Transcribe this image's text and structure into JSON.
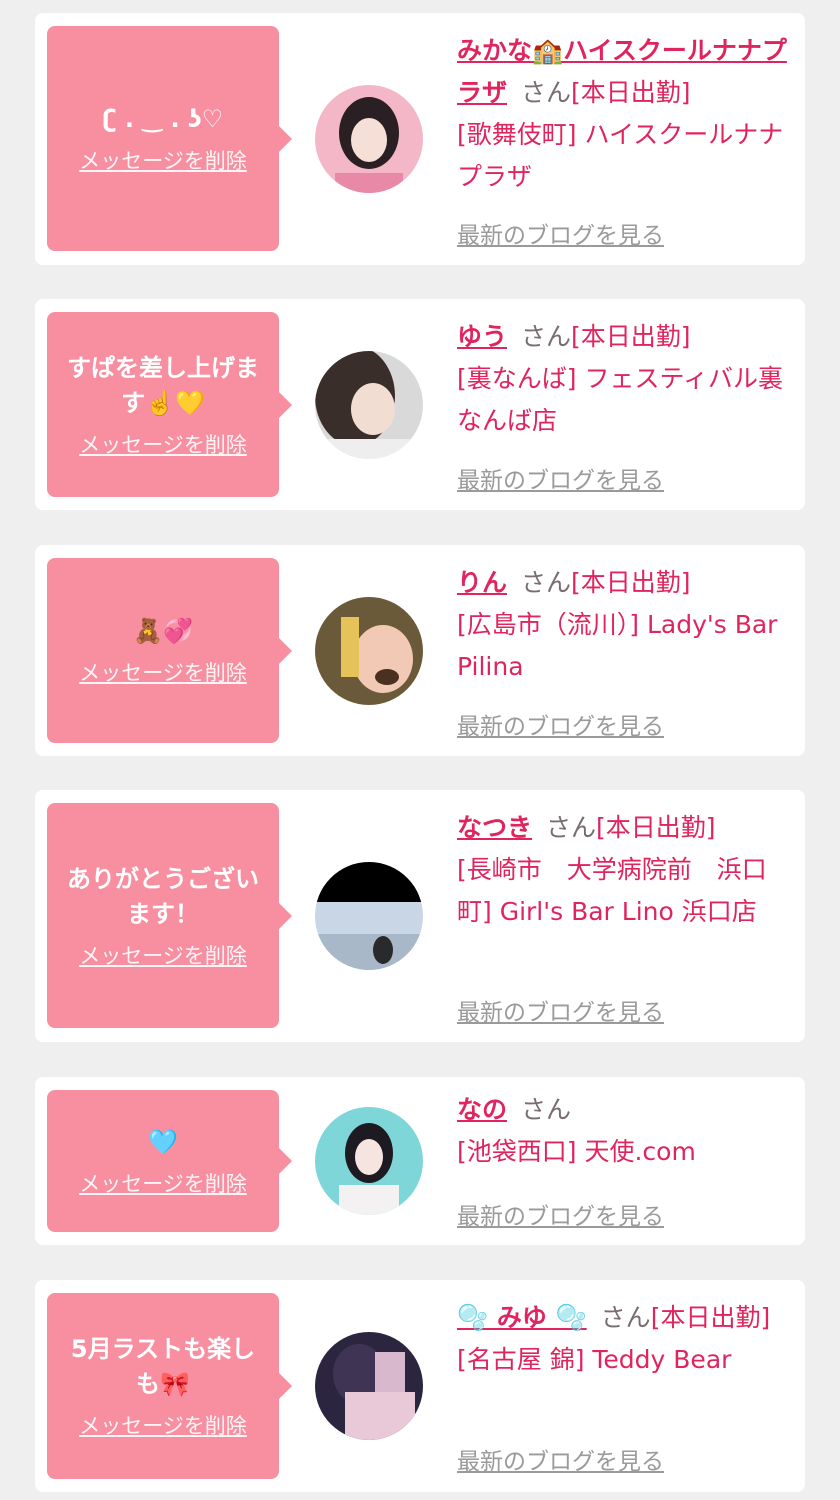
{
  "cards": [
    {
      "message": "ʗ . ‿ . ʖ♡",
      "delete_label": "メッセージを削除",
      "name": "みかな🏫ハイスクールナナプラザ",
      "honorific": "さん",
      "status": "[本日出勤]",
      "shop": "[歌舞伎町] ハイスクールナナプラザ",
      "blog_label": "最新のブログを見る",
      "avatar_colors": [
        "#f3b7c8",
        "#2a2024"
      ]
    },
    {
      "message": "すぱを差し上げます☝️💛",
      "delete_label": "メッセージを削除",
      "name": "ゆう",
      "honorific": "さん",
      "status": "[本日出勤]",
      "shop": "[裏なんば] フェスティバル裏なんば店",
      "blog_label": "最新のブログを見る",
      "avatar_colors": [
        "#d9d9d9",
        "#3a2e2a"
      ]
    },
    {
      "message": "🧸💞",
      "delete_label": "メッセージを削除",
      "name": "りん",
      "honorific": "さん",
      "status": "[本日出勤]",
      "shop": "[広島市（流川）] Lady's Bar Pilina",
      "blog_label": "最新のブログを見る",
      "avatar_colors": [
        "#6b5a3a",
        "#f1c9b4"
      ]
    },
    {
      "message": "ありがとうございます！",
      "delete_label": "メッセージを削除",
      "name": "なつき",
      "honorific": "さん",
      "status": "[本日出勤]",
      "shop": "[長崎市　大学病院前　浜口町] Girl's Bar Lino 浜口店",
      "blog_label": "最新のブログを見る",
      "avatar_colors": [
        "#000000",
        "#c9d6e6"
      ]
    },
    {
      "message": "🩵",
      "delete_label": "メッセージを削除",
      "name": "なの",
      "honorific": "さん",
      "status": "",
      "shop": "[池袋西口] 天使.com",
      "blog_label": "最新のブログを見る",
      "avatar_colors": [
        "#7fd6d9",
        "#f4f1f3"
      ]
    },
    {
      "message": "5月ラストも楽しも🎀",
      "delete_label": "メッセージを削除",
      "name": "🫧 みゆ 🫧",
      "honorific": "さん",
      "status": "[本日出勤]",
      "shop": "[名古屋 錦] Teddy Bear",
      "blog_label": "最新のブログを見る",
      "avatar_colors": [
        "#2b2540",
        "#e9c9d8"
      ]
    }
  ]
}
